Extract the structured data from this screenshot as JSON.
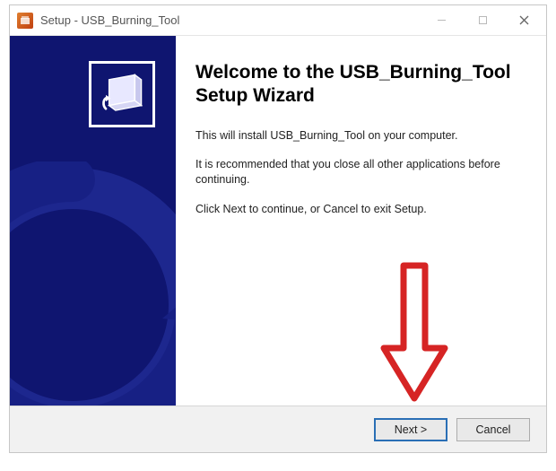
{
  "titlebar": {
    "title": "Setup - USB_Burning_Tool"
  },
  "content": {
    "heading": "Welcome to the USB_Burning_Tool Setup Wizard",
    "para1": "This will install USB_Burning_Tool on your computer.",
    "para2": "It is recommended that you close all other applications before continuing.",
    "para3": "Click Next to continue, or Cancel to exit Setup."
  },
  "footer": {
    "next_label": "Next >",
    "cancel_label": "Cancel"
  },
  "annotation": {
    "arrow_color": "#d62424"
  }
}
